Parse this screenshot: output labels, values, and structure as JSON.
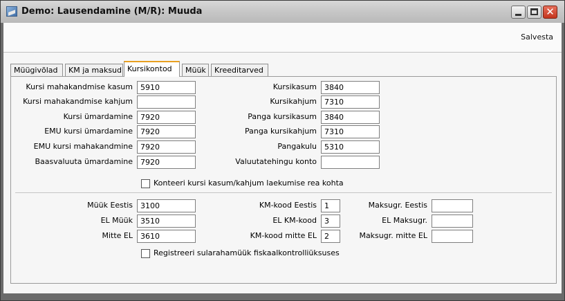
{
  "window": {
    "title": "Demo: Lausendamine (M/R): Muuda"
  },
  "toolbar": {
    "save_label": "Salvesta"
  },
  "tabs": [
    {
      "label": "Müügivõlad"
    },
    {
      "label": "KM ja maksud"
    },
    {
      "label": "Kursikontod"
    },
    {
      "label": "Müük"
    },
    {
      "label": "Kreeditarved"
    }
  ],
  "active_tab": "Kursikontod",
  "left_fields": [
    {
      "label": "Kursi mahakandmise kasum",
      "value": "5910"
    },
    {
      "label": "Kursi mahakandmise kahjum",
      "value": ""
    },
    {
      "label": "Kursi ümardamine",
      "value": "7920"
    },
    {
      "label": "EMU kursi ümardamine",
      "value": "7920"
    },
    {
      "label": "EMU kursi mahakandmine",
      "value": "7920"
    },
    {
      "label": "Baasvaluuta ümardamine",
      "value": "7920"
    }
  ],
  "right_fields": [
    {
      "label": "Kursikasum",
      "value": "3840"
    },
    {
      "label": "Kursikahjum",
      "value": "7310"
    },
    {
      "label": "Panga kursikasum",
      "value": "3840"
    },
    {
      "label": "Panga kursikahjum",
      "value": "7310"
    },
    {
      "label": "Pangakulu",
      "value": "5310"
    },
    {
      "label": "Valuutatehingu konto",
      "value": ""
    }
  ],
  "checkbox_top": {
    "label": "Konteeri kursi kasum/kahjum laekumise rea kohta",
    "checked": false
  },
  "sales_fields": [
    {
      "label": "Müük Eestis",
      "value": "3100"
    },
    {
      "label": "EL Müük",
      "value": "3510"
    },
    {
      "label": "Mitte EL",
      "value": "3610"
    }
  ],
  "km_fields": [
    {
      "label": "KM-kood Eestis",
      "value": "1"
    },
    {
      "label": "EL KM-kood",
      "value": "3"
    },
    {
      "label": "KM-kood mitte EL",
      "value": "2"
    }
  ],
  "maksugr_fields": [
    {
      "label": "Maksugr. Eestis",
      "value": ""
    },
    {
      "label": "EL Maksugr.",
      "value": ""
    },
    {
      "label": "Maksugr. mitte EL",
      "value": ""
    }
  ],
  "checkbox_bottom": {
    "label": "Registreeri sularahamüük fiskaalkontrolliüksuses",
    "checked": false
  },
  "colors": {
    "active_tab_accent": "#e8a020",
    "close_button": "#c4341c"
  }
}
